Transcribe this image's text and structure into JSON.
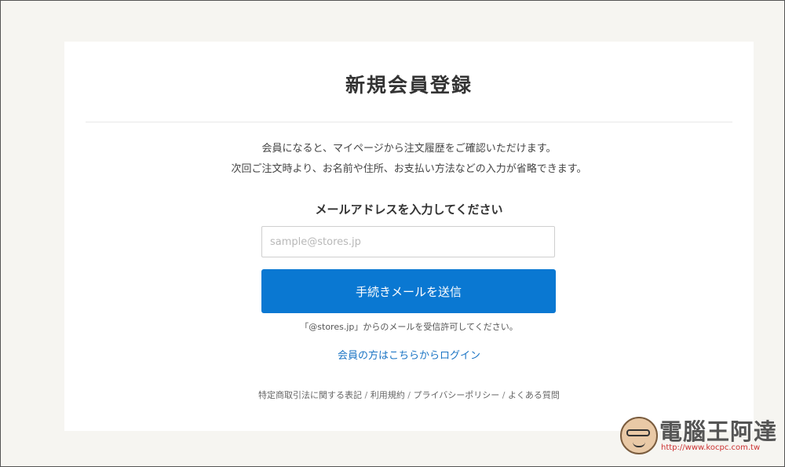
{
  "page": {
    "title": "新規会員登録",
    "description": [
      "会員になると、マイページから注文履歴をご確認いただけます。",
      "次回ご注文時より、お名前や住所、お支払い方法などの入力が省略できます。"
    ]
  },
  "form": {
    "email_label": "メールアドレスを入力してください",
    "email_placeholder": "sample@stores.jp",
    "email_value": "",
    "submit_label": "手続きメールを送信",
    "note": "「@stores.jp」からのメールを受信許可してください。",
    "login_link": "会員の方はこちらからログイン"
  },
  "footer": {
    "links": [
      "特定商取引法に関する表記",
      "利用規約",
      "プライバシーポリシー",
      "よくある質問"
    ],
    "separator": " / "
  },
  "watermark": {
    "name": "電腦王阿達",
    "url": "http://www.kocpc.com.tw"
  },
  "colors": {
    "accent": "#0a78d2",
    "link": "#1a74c4",
    "background": "#f6f5f1"
  }
}
